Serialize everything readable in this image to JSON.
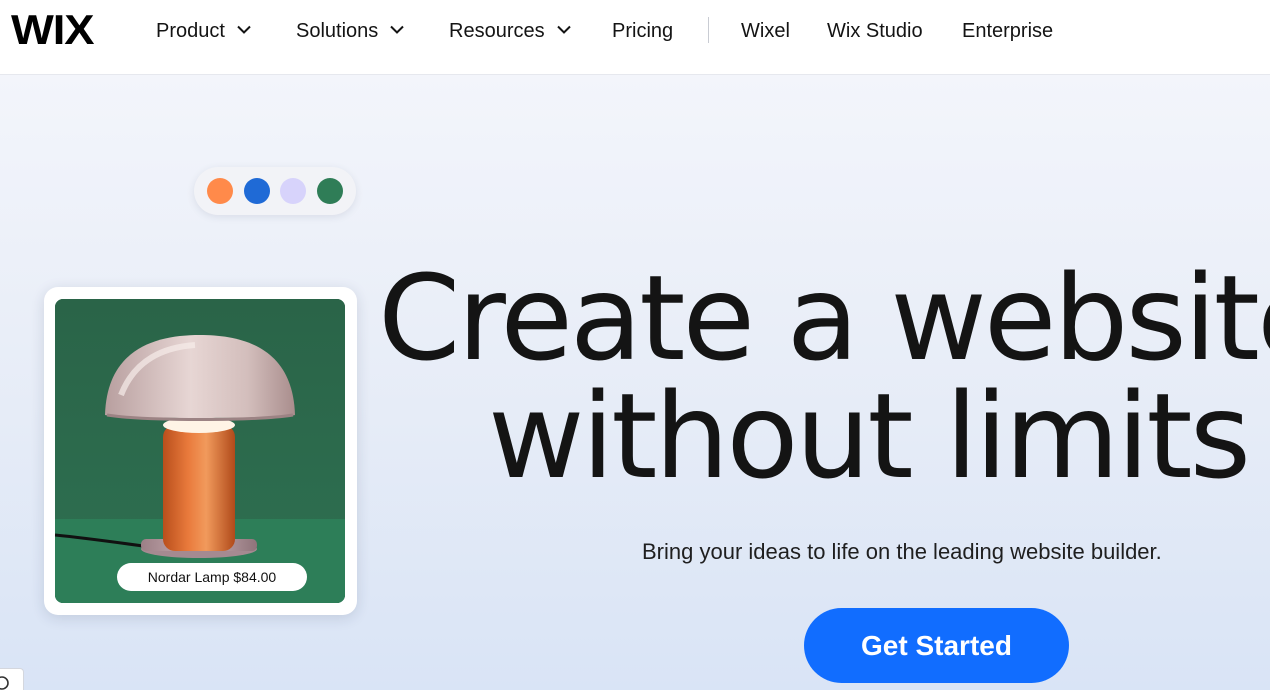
{
  "brand": {
    "logo_text": "WIX"
  },
  "nav": {
    "items": [
      {
        "label": "Product",
        "has_dropdown": true
      },
      {
        "label": "Solutions",
        "has_dropdown": true
      },
      {
        "label": "Resources",
        "has_dropdown": true
      },
      {
        "label": "Pricing",
        "has_dropdown": false
      },
      {
        "label": "Wixel",
        "has_dropdown": false
      },
      {
        "label": "Wix Studio",
        "has_dropdown": false
      },
      {
        "label": "Enterprise",
        "has_dropdown": false
      }
    ],
    "dropdown_icon": "chevron-down-icon"
  },
  "hero": {
    "swatches": [
      {
        "name": "orange",
        "color": "#ff8a4a"
      },
      {
        "name": "blue",
        "color": "#1f6ad6"
      },
      {
        "name": "lavender",
        "color": "#d7d3fb"
      },
      {
        "name": "green",
        "color": "#2f7d57"
      }
    ],
    "product_card": {
      "label": "Nordar Lamp $84.00",
      "image": "mushroom-lamp-photo"
    },
    "headline_line1": "Create a website",
    "headline_line2": "without limits",
    "subtitle": "Bring your ideas to life on the leading website builder.",
    "cta_label": "Get Started"
  },
  "colors": {
    "accent": "#116dff",
    "text": "#141414",
    "hero_bg_top": "#f3f5fb",
    "hero_bg_bottom": "#d9e4f6",
    "photo_green": "#2f6b4e"
  }
}
